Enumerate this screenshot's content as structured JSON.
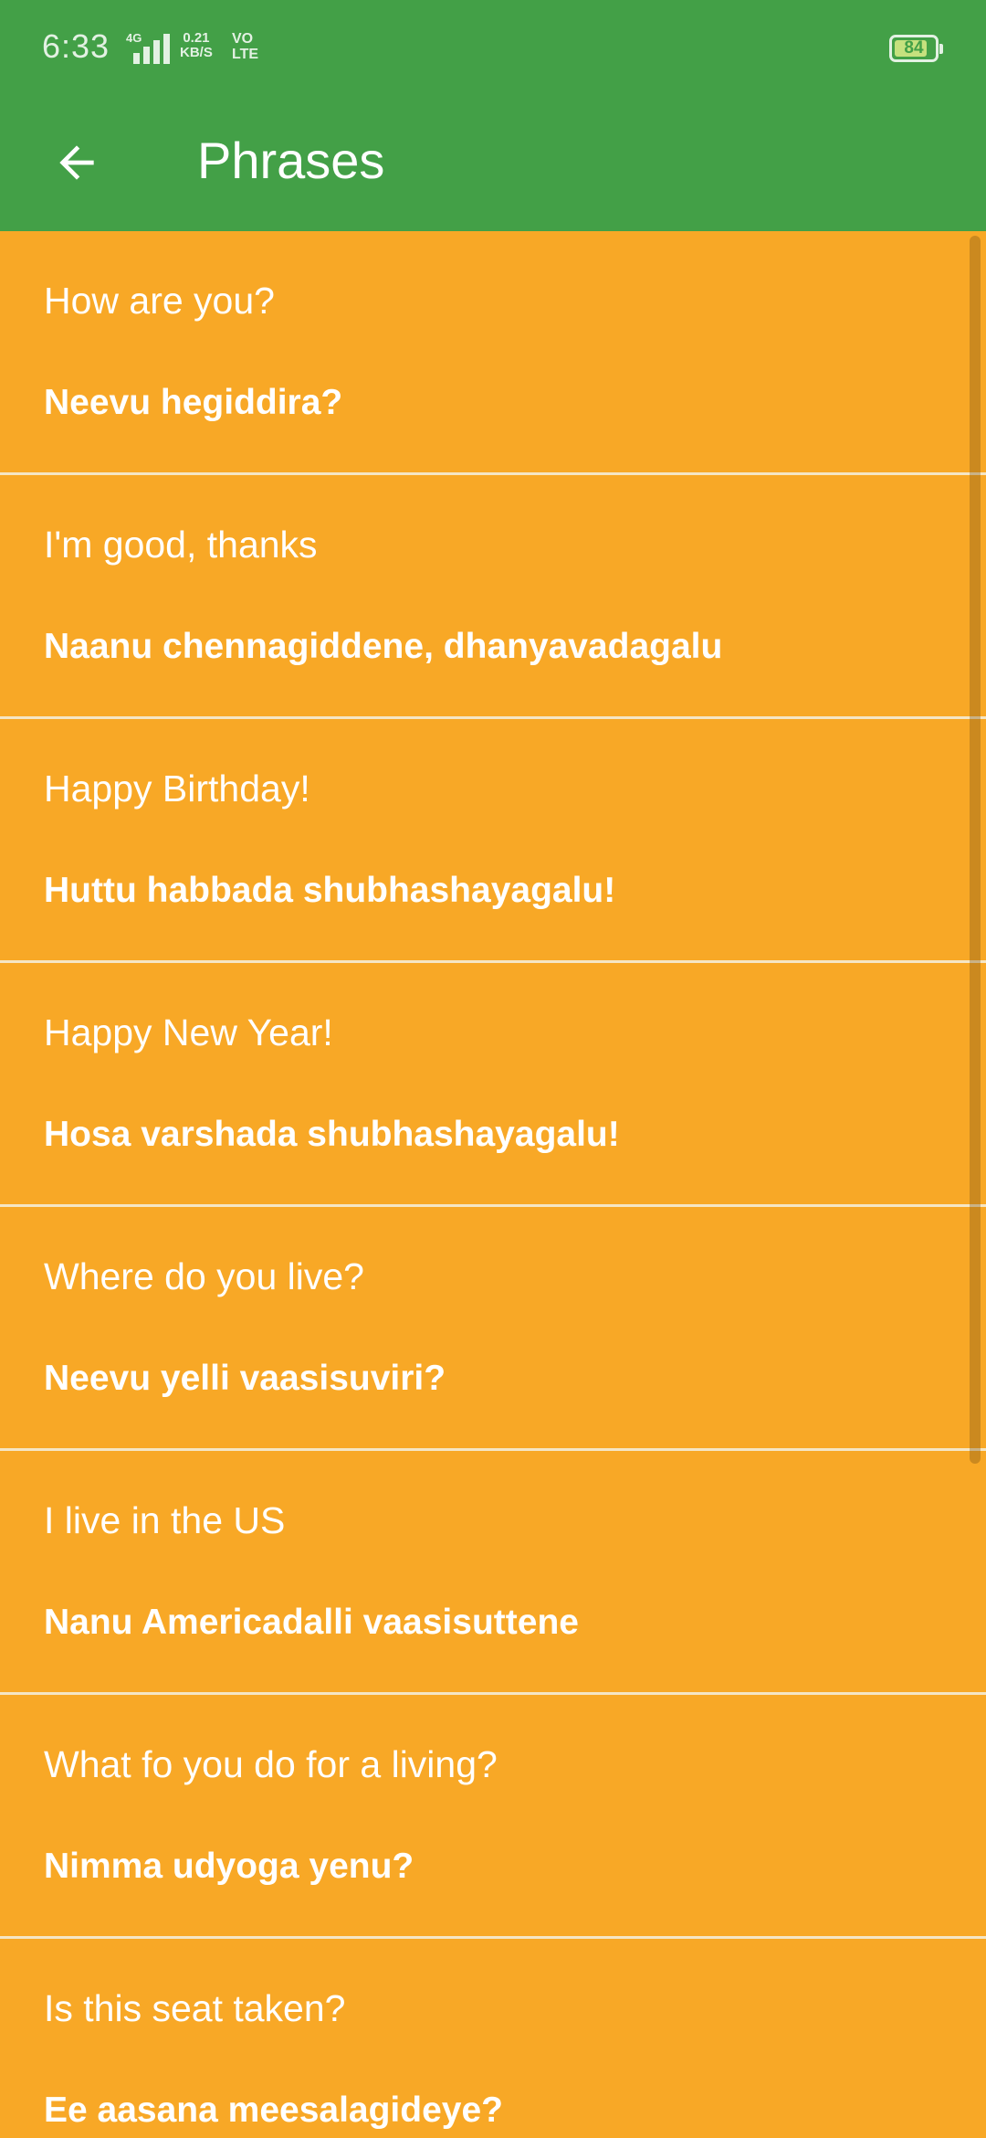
{
  "status_bar": {
    "time": "6:33",
    "network_type": "4G",
    "speed_value": "0.21",
    "speed_unit": "KB/S",
    "volte_top": "VO",
    "volte_bottom": "LTE",
    "battery_level": "84",
    "battery_fraction": 0.84
  },
  "app_bar": {
    "title": "Phrases",
    "back_icon": "arrow-left-icon"
  },
  "phrases": [
    {
      "english": "How are you?",
      "kannada": "Neevu hegiddira?"
    },
    {
      "english": "I'm good, thanks",
      "kannada": "Naanu chennagiddene, dhanyavadagalu"
    },
    {
      "english": "Happy Birthday!",
      "kannada": "Huttu habbada shubhashayagalu!"
    },
    {
      "english": "Happy New Year!",
      "kannada": "Hosa varshada shubhashayagalu!"
    },
    {
      "english": "Where do you live?",
      "kannada": "Neevu yelli vaasisuviri?"
    },
    {
      "english": "I live in the US",
      "kannada": "Nanu Americadalli vaasisuttene"
    },
    {
      "english": "What fo you do for a living?",
      "kannada": "Nimma udyoga yenu?"
    },
    {
      "english": "Is this seat taken?",
      "kannada": "Ee aasana meesalagideye?"
    }
  ],
  "colors": {
    "app_bar": "#43A047",
    "list_background": "#F8A826",
    "divider": "#F5E6C5",
    "text": "#FFFFFF"
  }
}
